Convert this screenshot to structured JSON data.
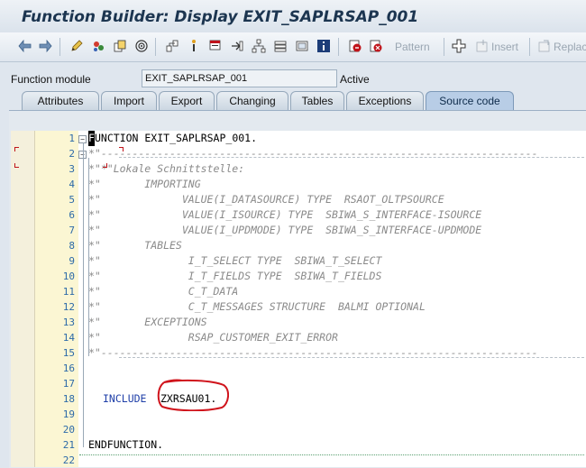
{
  "window": {
    "title": "Function Builder: Display EXIT_SAPLRSAP_001"
  },
  "toolbar": {
    "pattern_label": "Pattern",
    "insert_label": "Insert",
    "replace_label": "Replac",
    "icons": [
      "back-icon",
      "forward-icon",
      "pencil-icon",
      "display-change-icon",
      "activate-icon",
      "where-used-icon",
      "object-list-icon",
      "cursor-icon",
      "stack-icon",
      "navigation-icon",
      "hierarchy-icon",
      "display-object-icon",
      "frame-icon",
      "info-icon",
      "breakpoint-icon",
      "session-breakpoint-icon",
      "insert-icon",
      "replace-icon"
    ]
  },
  "function_module": {
    "label": "Function module",
    "value": "EXIT_SAPLRSAP_001",
    "status": "Active"
  },
  "tabs": [
    {
      "label": "Attributes"
    },
    {
      "label": "Import"
    },
    {
      "label": "Export"
    },
    {
      "label": "Changing"
    },
    {
      "label": "Tables"
    },
    {
      "label": "Exceptions"
    },
    {
      "label": "Source code"
    }
  ],
  "active_tab": "Source code",
  "code": {
    "lines": [
      {
        "num": "1",
        "text": "UNCTION EXIT_SAPLRSAP_001.",
        "first_char": "F",
        "style": "plain"
      },
      {
        "num": "2",
        "text": "*\"----------------------------------------------------------------------",
        "style": "comment"
      },
      {
        "num": "3",
        "text": "*\"*\"Lokale Schnittstelle:",
        "style": "comment"
      },
      {
        "num": "4",
        "text": "*\"       IMPORTING",
        "style": "comment"
      },
      {
        "num": "5",
        "text": "*\"             VALUE(I_DATASOURCE) TYPE  RSAOT_OLTPSOURCE",
        "style": "comment"
      },
      {
        "num": "6",
        "text": "*\"             VALUE(I_ISOURCE) TYPE  SBIWA_S_INTERFACE-ISOURCE",
        "style": "comment"
      },
      {
        "num": "7",
        "text": "*\"             VALUE(I_UPDMODE) TYPE  SBIWA_S_INTERFACE-UPDMODE",
        "style": "comment"
      },
      {
        "num": "8",
        "text": "*\"       TABLES",
        "style": "comment"
      },
      {
        "num": "9",
        "text": "*\"              I_T_SELECT TYPE  SBIWA_T_SELECT",
        "style": "comment"
      },
      {
        "num": "10",
        "text": "*\"              I_T_FIELDS TYPE  SBIWA_T_FIELDS",
        "style": "comment"
      },
      {
        "num": "11",
        "text": "*\"              C_T_DATA",
        "style": "comment"
      },
      {
        "num": "12",
        "text": "*\"              C_T_MESSAGES STRUCTURE  BALMI OPTIONAL",
        "style": "comment"
      },
      {
        "num": "13",
        "text": "*\"       EXCEPTIONS",
        "style": "comment"
      },
      {
        "num": "14",
        "text": "*\"              RSAP_CUSTOMER_EXIT_ERROR",
        "style": "comment"
      },
      {
        "num": "15",
        "text": "*\"----------------------------------------------------------------------",
        "style": "comment"
      },
      {
        "num": "16",
        "text": "",
        "style": "plain"
      },
      {
        "num": "17",
        "text": "",
        "style": "plain"
      },
      {
        "num": "18",
        "text": "ZXRSAU01.",
        "keyword": "INCLUDE",
        "style": "include"
      },
      {
        "num": "19",
        "text": "",
        "style": "plain"
      },
      {
        "num": "20",
        "text": "",
        "style": "plain"
      },
      {
        "num": "21",
        "text": "ENDFUNCTION.",
        "style": "plain"
      },
      {
        "num": "22",
        "text": "",
        "style": "plain"
      }
    ]
  },
  "colors": {
    "annotation_circle": "#d0141c",
    "comment_text": "#8a8a8a",
    "keyword_text": "#1f3fa8",
    "line_number": "#2d6aa8"
  }
}
